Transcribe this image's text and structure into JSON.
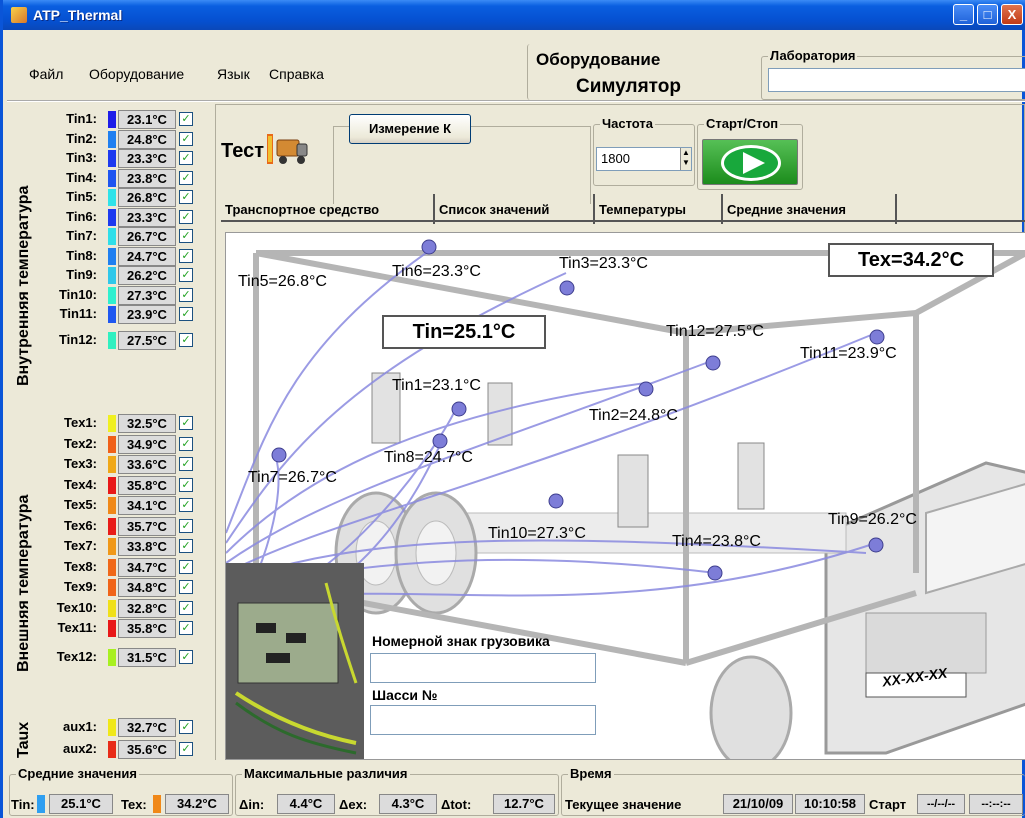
{
  "window": {
    "title": "ATP_Thermal",
    "minimize": "_",
    "maximize": "□",
    "close": "X"
  },
  "menu": [
    "Файл",
    "Оборудование",
    "Язык",
    "Справка"
  ],
  "equipment": {
    "label": "Оборудование",
    "value": "Симулятор"
  },
  "lab": {
    "label": "Лаборатория",
    "value": ""
  },
  "test": {
    "label": "Тест",
    "measure_button": "Измерение К",
    "frequency_label": "Частота",
    "frequency_value": "1800",
    "startstop_label": "Старт/Стоп"
  },
  "sidebar": {
    "inner_title": "Внутренняя температура",
    "outer_title": "Внешняя температура",
    "aux_title": "Taux",
    "inner": [
      {
        "name": "Tin1:",
        "value": "23.1°C",
        "color": "#1d1de8"
      },
      {
        "name": "Tin2:",
        "value": "24.8°C",
        "color": "#1f7ff0"
      },
      {
        "name": "Tin3:",
        "value": "23.3°C",
        "color": "#1d3aef"
      },
      {
        "name": "Tin4:",
        "value": "23.8°C",
        "color": "#1f55f0"
      },
      {
        "name": "Tin5:",
        "value": "26.8°C",
        "color": "#2fe3e9"
      },
      {
        "name": "Tin6:",
        "value": "23.3°C",
        "color": "#1d3aef"
      },
      {
        "name": "Tin7:",
        "value": "26.7°C",
        "color": "#2fdfe9"
      },
      {
        "name": "Tin8:",
        "value": "24.7°C",
        "color": "#1f7ff0"
      },
      {
        "name": "Tin9:",
        "value": "26.2°C",
        "color": "#2fc8ea"
      },
      {
        "name": "Tin10:",
        "value": "27.3°C",
        "color": "#2ff0cf"
      },
      {
        "name": "Tin11:",
        "value": "23.9°C",
        "color": "#1f57f0"
      },
      {
        "name": "Tin12:",
        "value": "27.5°C",
        "color": "#30f0c0"
      }
    ],
    "outer": [
      {
        "name": "Tex1:",
        "value": "32.5°C",
        "color": "#f0f020"
      },
      {
        "name": "Tex2:",
        "value": "34.9°C",
        "color": "#f06018"
      },
      {
        "name": "Tex3:",
        "value": "33.6°C",
        "color": "#f0a818"
      },
      {
        "name": "Tex4:",
        "value": "35.8°C",
        "color": "#e81818"
      },
      {
        "name": "Tex5:",
        "value": "34.1°C",
        "color": "#f08818"
      },
      {
        "name": "Tex6:",
        "value": "35.7°C",
        "color": "#e81c18"
      },
      {
        "name": "Tex7:",
        "value": "33.8°C",
        "color": "#f09818"
      },
      {
        "name": "Tex8:",
        "value": "34.7°C",
        "color": "#f06818"
      },
      {
        "name": "Tex9:",
        "value": "34.8°C",
        "color": "#f06418"
      },
      {
        "name": "Tex10:",
        "value": "32.8°C",
        "color": "#f0e018"
      },
      {
        "name": "Tex11:",
        "value": "35.8°C",
        "color": "#e81818"
      },
      {
        "name": "Tex12:",
        "value": "31.5°C",
        "color": "#a8f020"
      }
    ],
    "aux": [
      {
        "name": "aux1:",
        "value": "32.7°C",
        "color": "#f0e818"
      },
      {
        "name": "aux2:",
        "value": "35.6°C",
        "color": "#e82c18"
      }
    ]
  },
  "tabs": [
    "Транспортное средство",
    "Список значений",
    "Температуры",
    "Средние значения"
  ],
  "scene": {
    "tin_avg": "Tin=25.1°C",
    "tex_avg": "Tex=34.2°C",
    "sensors": [
      {
        "label": "Tin5=26.8°C"
      },
      {
        "label": "Tin6=23.3°C"
      },
      {
        "label": "Tin3=23.3°C"
      },
      {
        "label": "Tin12=27.5°C"
      },
      {
        "label": "Tin11=23.9°C"
      },
      {
        "label": "Tin1=23.1°C"
      },
      {
        "label": "Tin2=24.8°C"
      },
      {
        "label": "Tin8=24.7°C"
      },
      {
        "label": "Tin7=26.7°C"
      },
      {
        "label": "Tin10=27.3°C"
      },
      {
        "label": "Tin4=23.8°C"
      },
      {
        "label": "Tin9=26.2°C"
      }
    ],
    "plate_label": "Номерной знак грузовика",
    "plate_value": "",
    "chassis_label": "Шасси №",
    "chassis_value": "",
    "license_plate": "XX-XX-XX"
  },
  "status": {
    "averages_label": "Средние значения",
    "tin_label": "Tin:",
    "tin_value": "25.1°C",
    "tin_color": "#2f9ff0",
    "tex_label": "Tex:",
    "tex_value": "34.2°C",
    "tex_color": "#f08818",
    "maxdiff_label": "Максимальные различия",
    "din_label": "Δin:",
    "din_value": "4.4°C",
    "dex_label": "Δex:",
    "dex_value": "4.3°C",
    "dtot_label": "Δtot:",
    "dtot_value": "12.7°C",
    "time_label": "Время",
    "current_label": "Текущее значение",
    "date_value": "21/10/09",
    "time_value": "10:10:58",
    "start_label": "Старт",
    "start_date": "--/--/--",
    "start_time": "--:--:--"
  }
}
